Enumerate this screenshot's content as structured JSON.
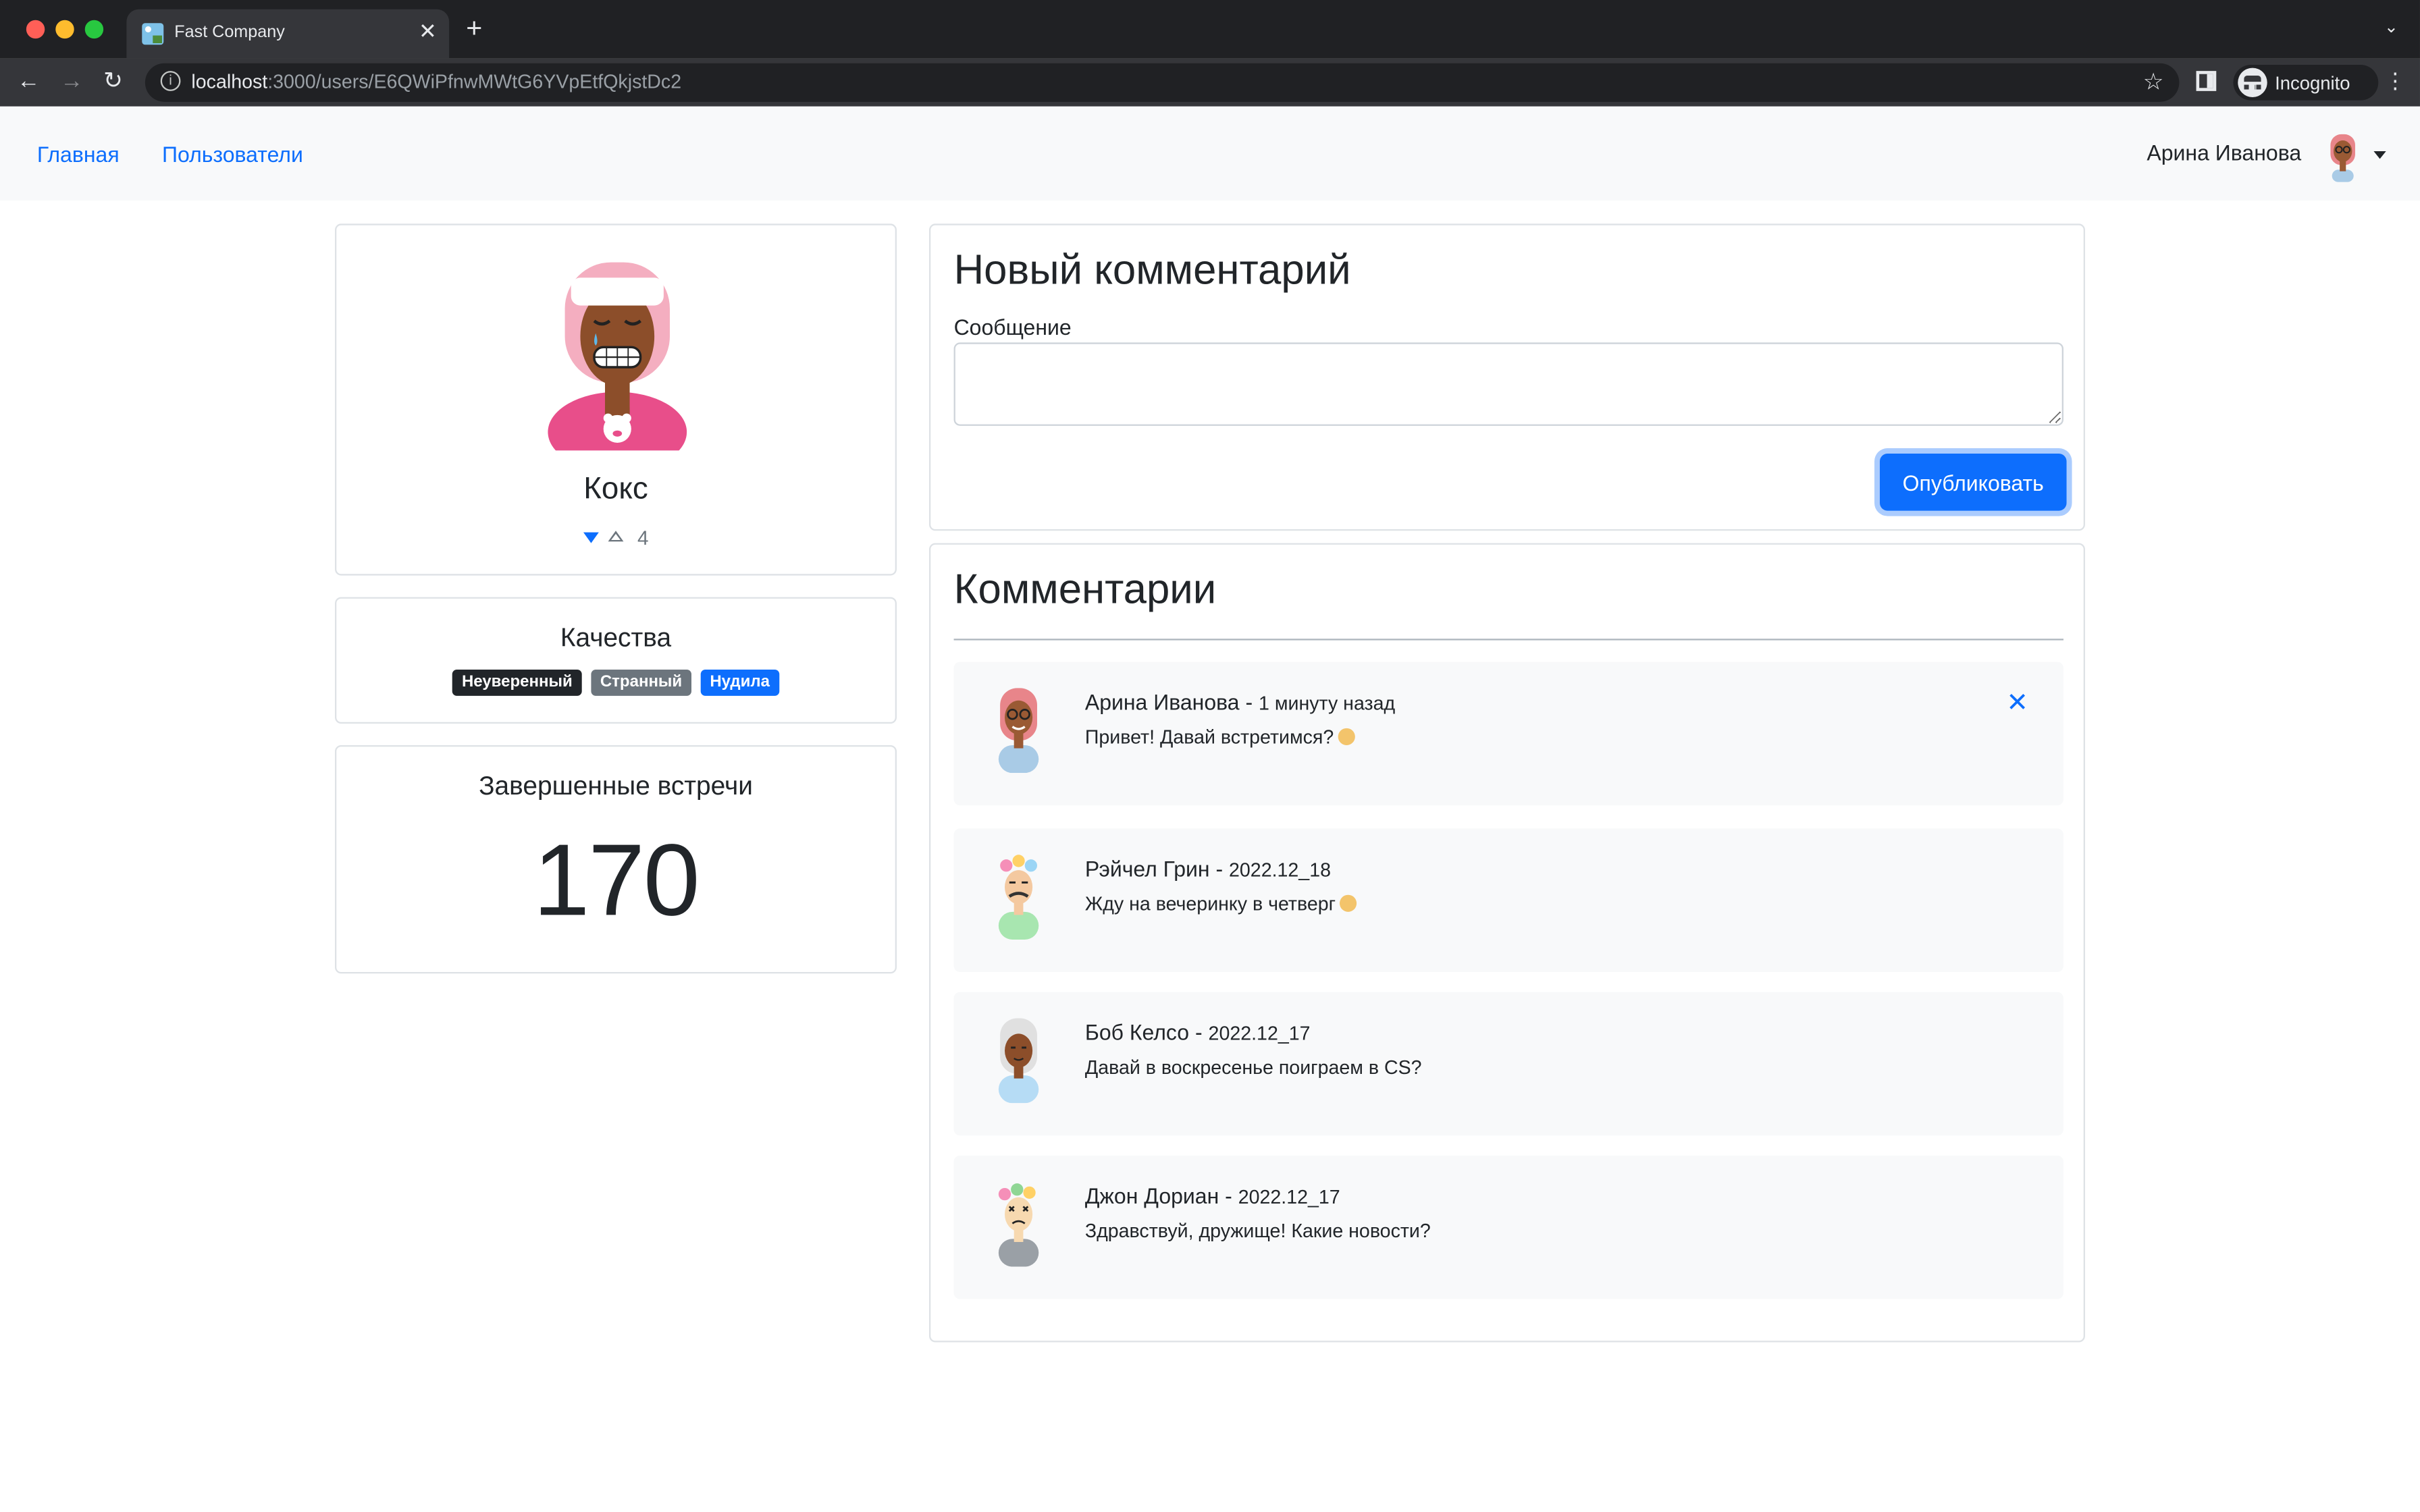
{
  "browser": {
    "tab_title": "Fast Company",
    "url_host": "localhost",
    "url_path": ":3000/users/E6QWiPfnwMWtG6YVpEtfQkjstDc2",
    "incognito_label": "Incognito"
  },
  "navbar": {
    "home": "Главная",
    "users": "Пользователи",
    "current_user": "Арина Иванова"
  },
  "profile": {
    "name": "Кокс",
    "rate": "4"
  },
  "qualities": {
    "title": "Качества",
    "items": [
      {
        "label": "Неуверенный",
        "color": "#212529"
      },
      {
        "label": "Странный",
        "color": "#6c757d"
      },
      {
        "label": "Нудила",
        "color": "#0d6efd"
      }
    ]
  },
  "meetings": {
    "title": "Завершенные встречи",
    "value": "170"
  },
  "new_comment": {
    "title": "Новый комментарий",
    "message_label": "Сообщение",
    "message_value": "",
    "submit_label": "Опубликовать"
  },
  "comments": {
    "title": "Комментарии",
    "items": [
      {
        "author": "Арина Иванова",
        "time": "1 минуту назад",
        "text": "Привет! Давай встретимся?",
        "emoji": true,
        "deletable": true
      },
      {
        "author": "Рэйчел Грин",
        "time": "2022.12_18",
        "text": "Жду на вечеринку в четверг",
        "emoji": true,
        "deletable": false
      },
      {
        "author": "Боб Келсо",
        "time": "2022.12_17",
        "text": "Давай в воскресенье поиграем в CS?",
        "emoji": false,
        "deletable": false
      },
      {
        "author": "Джон Дориан",
        "time": "2022.12_17",
        "text": "Здравствуй, дружище! Какие новости?",
        "emoji": false,
        "deletable": false
      }
    ]
  }
}
